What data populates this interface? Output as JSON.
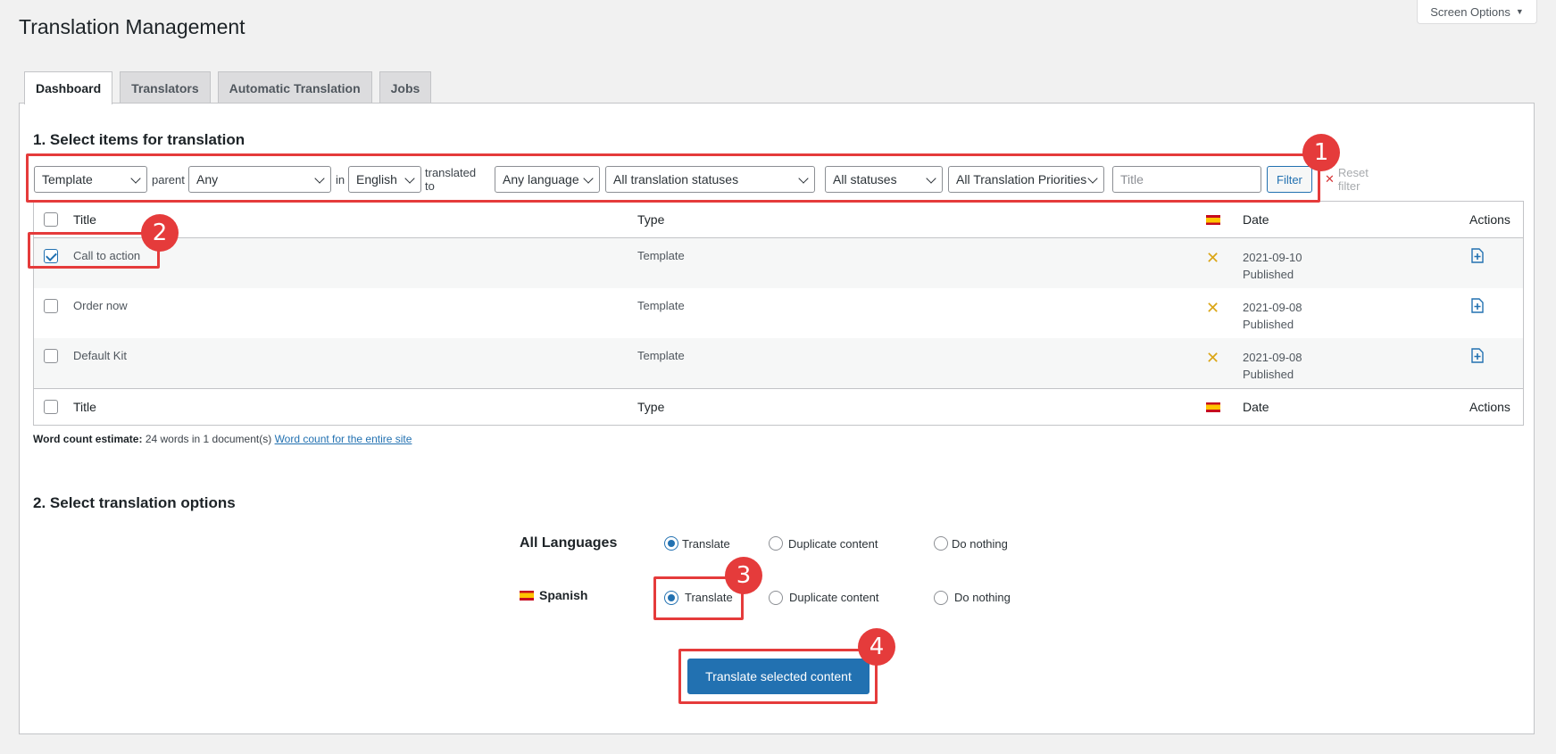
{
  "header": {
    "title": "Translation Management",
    "screen_options": "Screen Options"
  },
  "tabs": [
    {
      "label": "Dashboard",
      "active": true
    },
    {
      "label": "Translators"
    },
    {
      "label": "Automatic Translation"
    },
    {
      "label": "Jobs"
    }
  ],
  "section1": {
    "title": "1. Select items for translation",
    "filters": {
      "type": "Template",
      "parent_label": "parent",
      "parent": "Any",
      "in_label": "in",
      "source_language": "English",
      "translated_to_label": "translated to",
      "target_language": "Any language",
      "translation_status": "All translation statuses",
      "status": "All statuses",
      "priority": "All Translation Priorities",
      "title_placeholder": "Title",
      "filter_button": "Filter",
      "reset": "Reset filter"
    },
    "table": {
      "columns": {
        "title": "Title",
        "type": "Type",
        "date": "Date",
        "actions": "Actions"
      },
      "rows": [
        {
          "title": "Call to action",
          "type": "Template",
          "date": "2021-09-10",
          "status": "Published",
          "checked": true
        },
        {
          "title": "Order now",
          "type": "Template",
          "date": "2021-09-08",
          "status": "Published",
          "checked": false
        },
        {
          "title": "Default Kit",
          "type": "Template",
          "date": "2021-09-08",
          "status": "Published",
          "checked": false
        }
      ]
    },
    "word_count": {
      "label": "Word count estimate:",
      "value": "24 words in 1 document(s)",
      "link": "Word count for the entire site"
    }
  },
  "section2": {
    "title": "2. Select translation options",
    "all_languages": "All Languages",
    "spanish": "Spanish",
    "options": {
      "translate": "Translate",
      "duplicate": "Duplicate content",
      "nothing": "Do nothing"
    },
    "submit": "Translate selected content"
  },
  "annotations": [
    "1",
    "2",
    "3",
    "4"
  ],
  "colors": {
    "accent": "#2271b1",
    "highlight": "#e53b3b",
    "not_translated": "#dba617"
  }
}
